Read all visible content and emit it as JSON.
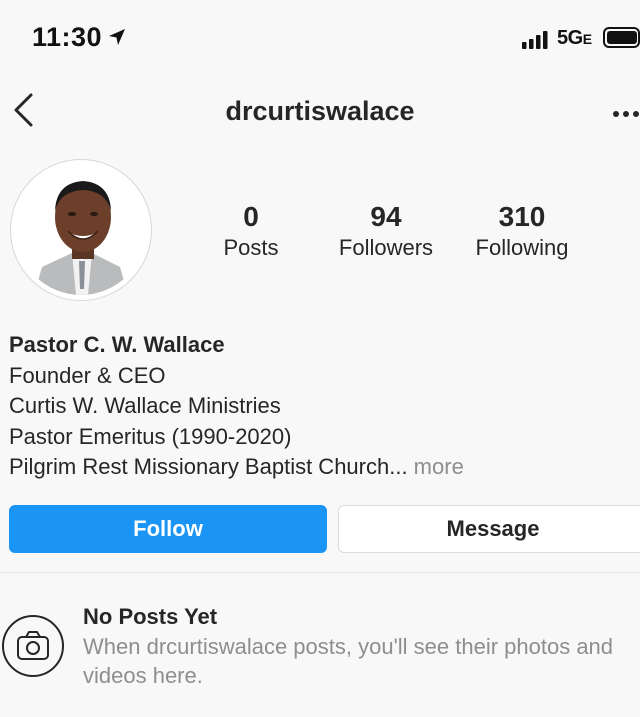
{
  "status_bar": {
    "time": "11:30",
    "network": "5G",
    "network_suffix": "E",
    "icons": [
      "location-arrow-icon",
      "signal-icon",
      "battery-icon"
    ]
  },
  "header": {
    "username": "drcurtiswalace",
    "icons": [
      "back-chevron-icon",
      "more-options-icon"
    ]
  },
  "profile": {
    "stats": [
      {
        "value": "0",
        "label": "Posts"
      },
      {
        "value": "94",
        "label": "Followers"
      },
      {
        "value": "310",
        "label": "Following"
      }
    ]
  },
  "bio": {
    "name": "Pastor C. W. Wallace",
    "lines": [
      "Founder & CEO",
      "Curtis W. Wallace Ministries",
      "Pastor Emeritus (1990-2020)",
      "Pilgrim Rest Missionary Baptist Church..."
    ],
    "more": " more"
  },
  "actions": {
    "follow_label": "Follow",
    "message_label": "Message"
  },
  "empty_state": {
    "title": "No Posts Yet",
    "text": "When drcurtiswalace posts, you'll see their photos and videos here.",
    "icon": "camera-icon"
  },
  "colors": {
    "accent": "#1b95f5",
    "text": "#262626",
    "secondary_text": "#8e8e8e",
    "background": "#f8f8f8"
  }
}
